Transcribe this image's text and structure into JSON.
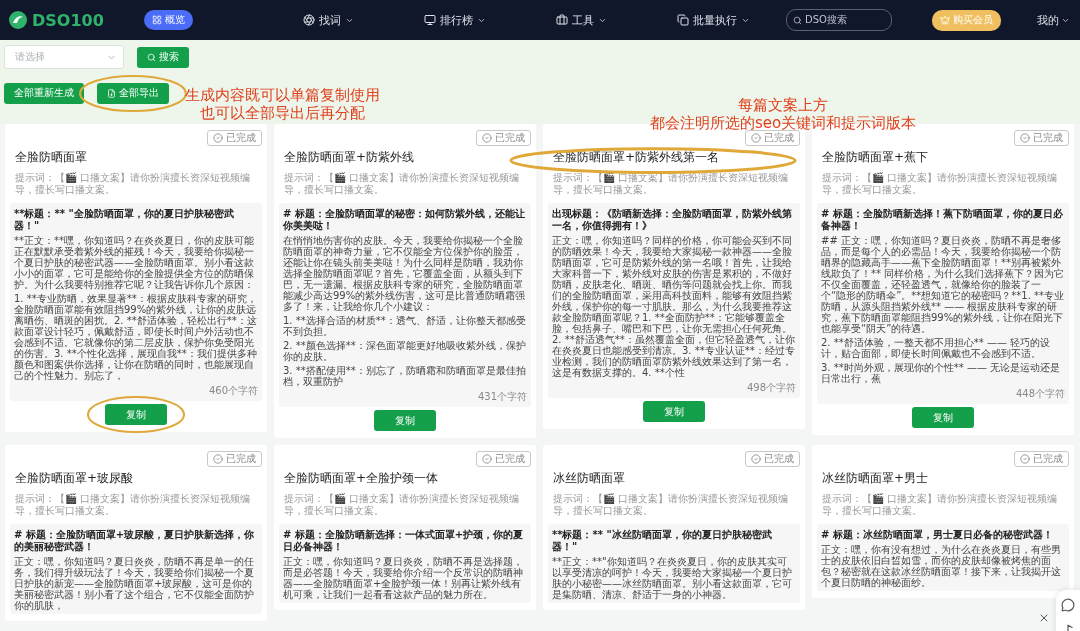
{
  "header": {
    "logo": "DSO100",
    "overview": "概览",
    "nav": [
      {
        "label": "找词"
      },
      {
        "label": "排行榜"
      },
      {
        "label": "工具"
      },
      {
        "label": "批量执行"
      }
    ],
    "search": {
      "placeholder": "DSO搜索"
    },
    "member_button": "购买会员",
    "account": "我的"
  },
  "toolbar": {
    "select": {
      "placeholder": "请选择"
    },
    "search_button": "搜索",
    "regenerate_button": "全部重新生成",
    "export_button": "全部导出",
    "export_circled": true
  },
  "annotations": [
    {
      "lines": [
        "生成内容既可以单篇复制使用",
        "也可以全部导出后再分配"
      ]
    },
    {
      "lines": [
        "每篇文案上方",
        "都会注明所选的seo关键词和提示词版本"
      ]
    }
  ],
  "cards": [
    {
      "status": "已完成",
      "title": "全脸防晒面罩",
      "prompt": "提示词：【🎬 口播文案】请你扮演擅长资深短视频编导，擅长写口播文案。",
      "heading": "**标题：** \"全脸防晒面罩，你的夏日护肤秘密武器！\"",
      "body": [
        "**正文：**嘿，你知道吗？在炎炎夏日，你的皮肤可能正在默默承受着紫外线的摧残！今天，我要给你揭秘一个夏日护肤的秘密武器——全脸防晒面罩。别小看这款小小的面罩，它可是能给你的全脸提供全方位的防晒保护。为什么我要特别推荐它呢？让我告诉你几个原因：",
        "1. **专业防晒，效果显著**：根据皮肤科专家的研究，全脸防晒面罩能有效阻挡99%的紫外线，让你的皮肤远离晒伤、晒斑的困扰。2. **舒适体验，轻松出行**：这款面罩设计轻巧，佩戴舒适，即使长时间户外活动也不会感到不适。它就像你的第二层皮肤，保护你免受阳光的伤害。3. **个性化选择，展现自我**：我们提供多种颜色和图案供你选择，让你在防晒的同时，也能展现自己的个性魅力。别忘了，"
      ],
      "char_count": "460个字符",
      "copy_button": "复制",
      "copy_circled": true
    },
    {
      "status": "已完成",
      "title": "全脸防晒面罩+防紫外线",
      "prompt": "提示词：【🎬 口播文案】请你扮演擅长资深短视频编导，擅长写口播文案。",
      "heading": "# 标题：全脸防晒面罩的秘密：如何防紫外线，还能让你美美哒！",
      "body": [
        "在悄悄地伤害你的皮肤。今天，我要给你揭秘一个全脸防晒面罩的神奇力量，它不仅能全方位保护你的脸蛋，还能让你在镜头前美美哒！为什么同样是防晒，我劝你选择全脸防晒面罩呢？首先，它覆盖全面，从额头到下巴，无一遗漏。根据皮肤科专家的研究，全脸防晒面罩能减少高达99%的紫外线伤害，这可是比普通防晒霜强多了！来，让我给你几个小建议：",
        "1. **选择合适的材质**：透气、舒适，让你整天都感受不到负担。",
        "2. **颜色选择**：深色面罩能更好地吸收紫外线，保护你的皮肤。",
        "3. **搭配使用**：别忘了，防晒霜和防晒面罩是最佳拍档，双重防护"
      ],
      "char_count": "431个字符",
      "copy_button": "复制",
      "copy_circled": false
    },
    {
      "status": "已完成",
      "title": "全脸防晒面罩+防紫外线第一名",
      "title_circled": true,
      "prompt": "提示词：【🎬 口播文案】请你扮演擅长资深短视频编导，擅长写口播文案。",
      "heading": "出现标题：《防晒新选择：全脸防晒面罩，防紫外线第一名，你值得拥有！》",
      "body": [
        "正文：嘿，你知道吗？同样的价格，你可能会买到不同的防晒效果！今天，我要给大家揭秘一款神器——全脸防晒面罩，它可是防紫外线的第一名哦！首先，让我给大家科普一下，紫外线对皮肤的伤害是累积的，不做好防晒，皮肤老化、晒斑、晒伤等问题就会找上你。而我们的全脸防晒面罩，采用高科技面料，能够有效阻挡紫外线，保护你的每一寸肌肤。那么，为什么我要推荐这款全脸防晒面罩呢？1. **全面防护**：它能够覆盖全脸，包括鼻子、嘴巴和下巴，让你无需担心任何死角。2. **舒适透气**：虽然覆盖全面，但它轻盈透气，让你在炎炎夏日也能感受到清凉。3. **专业认证**：经过专业检测，我们的防晒面罩防紫外线效果达到了第一名，这是有数据支撑的。4. **个性"
      ],
      "char_count": "498个字符",
      "copy_button": "复制",
      "copy_circled": false
    },
    {
      "status": "已完成",
      "title": "全脸防晒面罩+蕉下",
      "prompt": "提示词：【🎬 口播文案】请你扮演擅长资深短视频编导，擅长写口播文案。",
      "heading": "# 标题：全脸防晒新选择！蕉下防晒面罩，你的夏日必备神器！",
      "body": [
        "## 正文：嘿，你知道吗？夏日炎炎，防晒不再是奢侈品，而是每个人的必需品！今天，我要给你揭秘一个防晒界的隐藏高手——蕉下全脸防晒面罩！**别再被紫外线欺负了！** 同样价格，为什么我们选择蕉下？因为它不仅全面覆盖，还轻盈透气，就像给你的脸装了一个“隐形的防晒伞”。**想知道它的秘密吗？**1. **专业防晒，从源头阻挡紫外线** —— 根据皮肤科专家的研究，蕉下防晒面罩能阻挡99%的紫外线，让你在阳光下也能享受“阴天”的待遇。",
        "2. **舒适体验，一整天都不用担心** —— 轻巧的设计，贴合面部，即使长时间佩戴也不会感到不适。",
        "3. **时尚外观，展现你的个性** —— 无论是运动还是日常出行，蕉"
      ],
      "char_count": "448个字符",
      "copy_button": "复制",
      "copy_circled": false
    },
    {
      "status": "已完成",
      "title": "全脸防晒面罩+玻尿酸",
      "prompt": "提示词：【🎬 口播文案】请你扮演擅长资深短视频编导，擅长写口播文案。",
      "heading": "# 标题：全脸防晒面罩+玻尿酸，夏日护肤新选择，你的美丽秘密武器！",
      "body": [
        "正文：嘿，你知道吗？夏日炎炎，防晒不再是单一的任务，我们得升级玩法了！今天，我要给你们揭秘一个夏日护肤的新宠——全脸防晒面罩+玻尿酸，这可是你的美丽秘密武器！别小看了这个组合，它不仅能全面防护你的肌肤，"
      ]
    },
    {
      "status": "已完成",
      "title": "全脸防晒面罩+全脸护颈一体",
      "prompt": "提示词：【🎬 口播文案】请你扮演擅长资深短视频编导，擅长写口播文案。",
      "heading": "# 标题：全脸防晒新选择：一体式面罩+护颈，你的夏日必备神器！",
      "body": [
        "正文：嘿，你知道吗？夏日炎炎，防晒不再是选择题，而是必答题！今天，我要给你介绍一个反常识的防晒神器——全脸防晒面罩+全脸护颈一体！别再让紫外线有机可乘，让我们一起看看这款产品的魅力所在。"
      ]
    },
    {
      "status": "已完成",
      "title": "冰丝防晒面罩",
      "prompt": "提示词：【🎬 口播文案】请你扮演擅长资深短视频编导，擅长写口播文案。",
      "heading": "**标题：** \"冰丝防晒面罩，你的夏日护肤秘密武器！\"",
      "body": [
        "**正文：**\"你知道吗？在炎炎夏日，你的皮肤其实可以享受清凉的呵护！今天，我要给大家揭秘一个夏日护肤的小秘密——冰丝防晒面罩。别小看这款面罩，它可是集防晒、清凉、舒适于一身的小神器。"
      ]
    },
    {
      "status": "已完成",
      "title": "冰丝防晒面罩+男士",
      "prompt": "提示词：【🎬 口播文案】请你扮演擅长资深短视频编导，擅长写口播文案。",
      "heading": "# 标题：冰丝防晒面罩，男士夏日必备的秘密武器！",
      "body": [
        "正文：嘿，你有没有想过，为什么在炎炎夏日，有些男士的皮肤依旧白皙如雪，而你的皮肤却像被烤焦的面包？秘密就在这款冰丝防晒面罩！接下来，让我揭开这个夏日防晒的神秘面纱。"
      ]
    }
  ]
}
